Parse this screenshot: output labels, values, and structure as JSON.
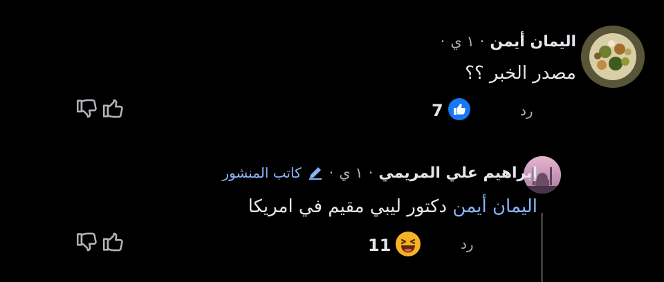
{
  "comments": [
    {
      "author": "اليمان أيمن",
      "time": "١ ي",
      "dot": "·",
      "text": "مصدر الخبر ؟؟",
      "reaction_count": "7",
      "reaction_icon": "like-icon",
      "reply_label": "رد"
    },
    {
      "author": "إبراهيم علي المريمي",
      "time": "١ ي",
      "dot": "·",
      "badge": "كاتب المنشور",
      "mention": "اليمان أيمن",
      "text": "دكتور ليبي مقيم في امريكا",
      "reaction_count": "11",
      "reaction_icon": "haha-icon",
      "reply_label": "رد"
    }
  ],
  "colors": {
    "background": "#000000",
    "text": "#e4e6eb",
    "muted": "#b0b3b8",
    "link": "#8ab4f8",
    "like_blue": "#1877f2",
    "haha_yellow": "#f7b125"
  }
}
